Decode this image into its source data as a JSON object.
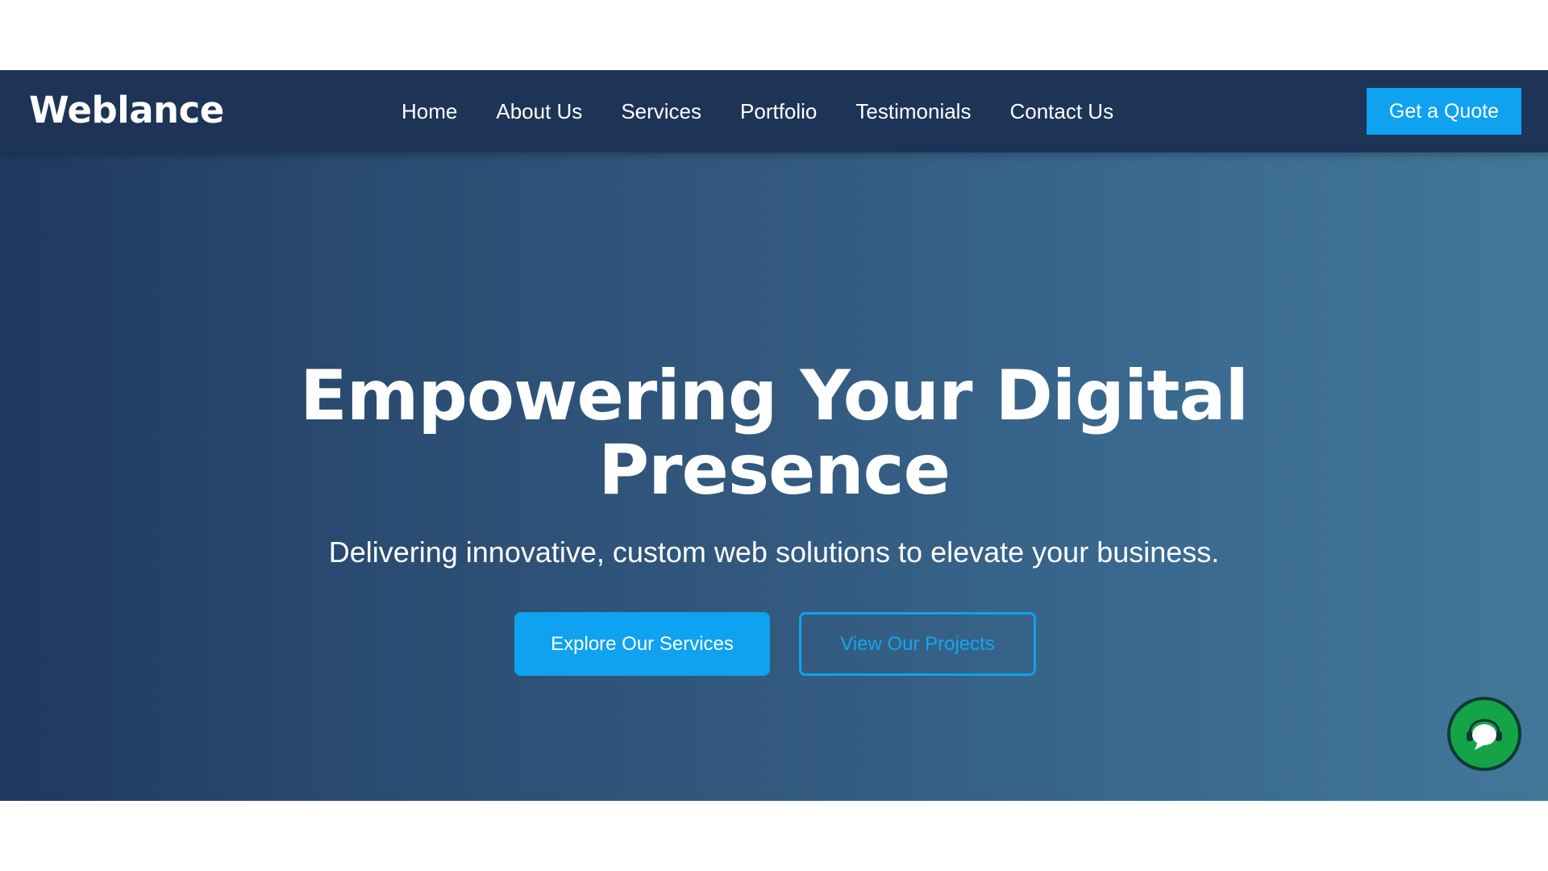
{
  "brand": {
    "name": "Weblance"
  },
  "nav": {
    "items": [
      {
        "label": "Home"
      },
      {
        "label": "About Us"
      },
      {
        "label": "Services"
      },
      {
        "label": "Portfolio"
      },
      {
        "label": "Testimonials"
      },
      {
        "label": "Contact Us"
      }
    ],
    "cta_label": "Get a Quote"
  },
  "hero": {
    "title_line1": "Empowering Your Digital",
    "title_line2": "Presence",
    "subtitle": "Delivering innovative, custom web solutions to elevate your business.",
    "primary_button": "Explore Our Services",
    "secondary_button": "View Our Projects"
  },
  "chat": {
    "icon": "chat-support-icon"
  },
  "colors": {
    "header_bg": "#1d3456",
    "accent": "#0ea2f0",
    "hero_gradient_start": "#1e3a5e",
    "hero_gradient_end": "#437798",
    "chat_green": "#14a447"
  }
}
